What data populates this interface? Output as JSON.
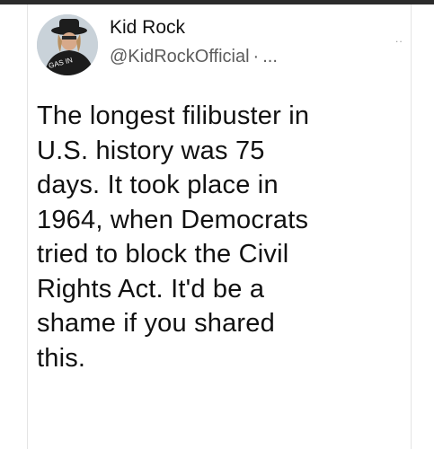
{
  "tweet": {
    "display_name": "Kid Rock",
    "handle": "@KidRockOfficial",
    "separator": "·",
    "more": "...",
    "corner_more": "..",
    "lines": [
      "The longest filibuster in",
      "U.S. history was 75",
      "days. It took place in",
      "1964, when Democrats",
      "tried to block the Civil",
      "Rights Act. It'd be a",
      "shame if you shared",
      "this."
    ]
  },
  "avatar": {
    "description_icon": "profile-photo",
    "shirt_text": "GAS IN"
  }
}
